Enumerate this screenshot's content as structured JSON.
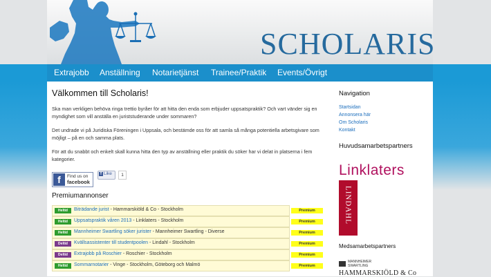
{
  "header": {
    "logo_text": "SCHOLARIS"
  },
  "nav": [
    {
      "label": "Extrajobb"
    },
    {
      "label": "Anställning"
    },
    {
      "label": "Notarietjänst"
    },
    {
      "label": "Trainee/Praktik"
    },
    {
      "label": "Events/Övrigt"
    }
  ],
  "main": {
    "title": "Välkommen till Scholaris!",
    "paragraphs": [
      "Ska man verkligen behöva ringa trettio byråer för att hitta den enda som erbjuder uppsatspraktik? Och vart vänder sig en myndighet som vill anställa en juriststuderande under sommaren?",
      "Det undrade vi på Juridiska Föreningen i Uppsala, och bestämde oss för att samla så många potentiella arbetsgivare som möjligt – på en och samma plats.",
      "För att du snabbt och enkelt skall kunna hitta den typ av anställning eller praktik du söker har vi delat in platserna i fem kategorier."
    ],
    "facebook": {
      "find_line1": "Find us on",
      "find_line2": "facebook",
      "like_label": "Like",
      "like_count": "1"
    },
    "premium_heading": "Premiumannonser",
    "ads": [
      {
        "badge": "Heltid",
        "badge_color": "#2e9c2e",
        "title": "Biträdande jurist",
        "rest": " - Hammarskiöld & Co - Stockholm",
        "premium": "Premium"
      },
      {
        "badge": "Heltid",
        "badge_color": "#2e9c2e",
        "title": "Uppsatspraktik våren 2013",
        "rest": " - Linklaters - Stockholm",
        "premium": "Premium"
      },
      {
        "badge": "Heltid",
        "badge_color": "#2e9c2e",
        "title": "Mannheimer Swartling söker jurister",
        "rest": " - Mannheimer Swartling - Diverse",
        "premium": "Premium"
      },
      {
        "badge": "Deltid",
        "badge_color": "#7b3a8c",
        "title": "Kvällsassistenter till studentpoolen",
        "rest": " - Lindahl - Stockholm",
        "premium": "Premium"
      },
      {
        "badge": "Deltid",
        "badge_color": "#7b3a8c",
        "title": "Extrajobb på Roschier",
        "rest": " - Roschier - Stockholm",
        "premium": "Premium"
      },
      {
        "badge": "Heltid",
        "badge_color": "#2e9c2e",
        "title": "Sommarnotarier",
        "rest": " - Vinge - Stockholm, Göteborg och Malmö",
        "premium": "Premium"
      }
    ]
  },
  "sidebar": {
    "nav_heading": "Navigation",
    "links": [
      {
        "label": "Startsidan"
      },
      {
        "label": "Annonsera här"
      },
      {
        "label": "Om Scholaris"
      },
      {
        "label": "Kontakt"
      }
    ],
    "main_partners_heading": "Huvudsamarbetspartners",
    "logo_linklaters": "Linklaters",
    "logo_lindahl": "LINDAHL",
    "partners_heading": "Medsamarbetspartners",
    "logo_mannheimer": "MANNHEIMER\nSWARTLING",
    "logo_hammarskiold": "HAMMARSKIÖLD & Co"
  }
}
